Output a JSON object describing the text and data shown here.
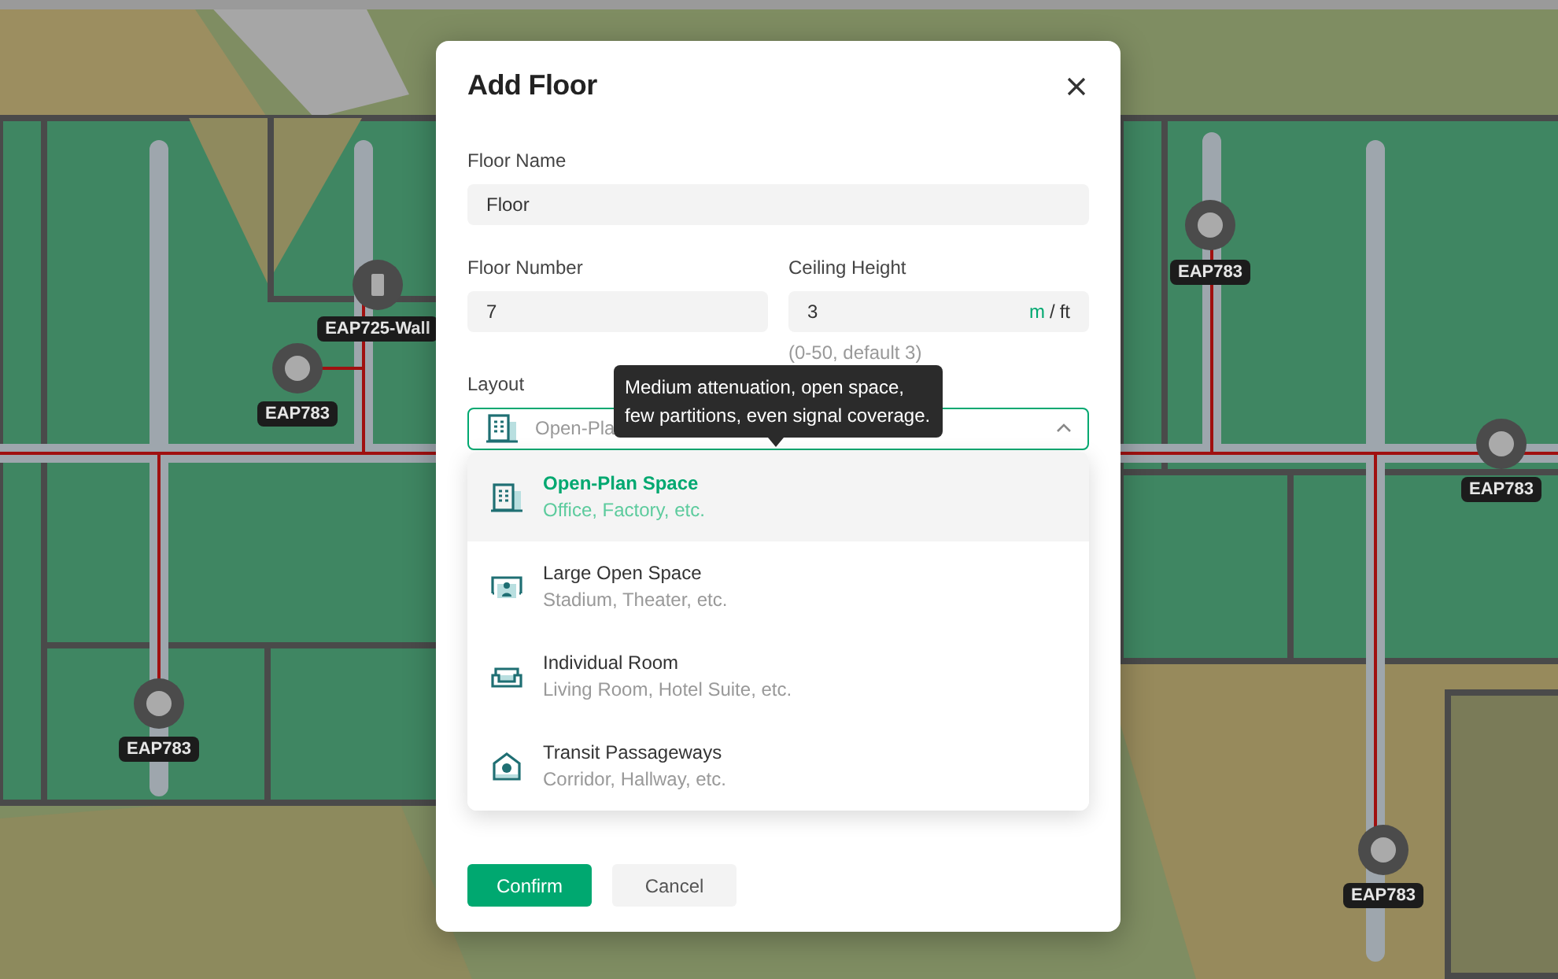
{
  "access_points": [
    {
      "label": "EAP725-Wall",
      "kind": "wall"
    },
    {
      "label": "EAP783",
      "kind": "ceiling"
    },
    {
      "label": "EAP783",
      "kind": "ceiling"
    },
    {
      "label": "EAP783",
      "kind": "ceiling"
    },
    {
      "label": "EAP783",
      "kind": "ceiling"
    },
    {
      "label": "EAP783",
      "kind": "ceiling"
    }
  ],
  "dialog": {
    "title": "Add Floor",
    "floor_name": {
      "label": "Floor Name",
      "value": "Floor"
    },
    "floor_number": {
      "label": "Floor Number",
      "value": "7"
    },
    "ceiling_height": {
      "label": "Ceiling Height",
      "value": "3",
      "units": [
        {
          "label": "m",
          "selected": true
        },
        {
          "label": "ft",
          "selected": false
        }
      ],
      "separator": "/",
      "hint": "(0-50, default 3)"
    },
    "layout": {
      "label": "Layout",
      "value": "Open-Pla",
      "expanded": true,
      "tooltip": "Medium attenuation, open space, few partitions, even signal coverage.",
      "options": [
        {
          "kind": "building",
          "title": "Open-Plan Space",
          "subtitle": "Office, Factory, etc.",
          "selected": true
        },
        {
          "kind": "stage",
          "title": "Large Open Space",
          "subtitle": "Stadium, Theater, etc.",
          "selected": false
        },
        {
          "kind": "sofa",
          "title": "Individual Room",
          "subtitle": "Living Room, Hotel Suite, etc.",
          "selected": false
        },
        {
          "kind": "house-pin",
          "title": "Transit Passageways",
          "subtitle": "Corridor, Hallway, etc.",
          "selected": false
        }
      ]
    },
    "buttons": [
      {
        "label": "Confirm",
        "kind": "primary"
      },
      {
        "label": "Cancel",
        "kind": "secondary"
      }
    ]
  }
}
